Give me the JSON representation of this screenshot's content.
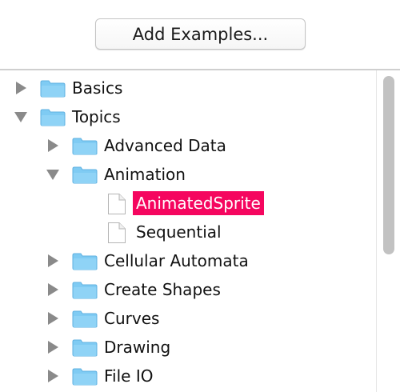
{
  "toolbar": {
    "add_examples_label": "Add Examples..."
  },
  "colors": {
    "folder": "#7fcbf3",
    "selection": "#f5065f",
    "disclosure": "#8a8a8a"
  },
  "tree": {
    "items": [
      {
        "label": "Basics",
        "type": "folder",
        "expanded": false
      },
      {
        "label": "Topics",
        "type": "folder",
        "expanded": true
      },
      {
        "label": "Advanced Data",
        "type": "folder",
        "expanded": false
      },
      {
        "label": "Animation",
        "type": "folder",
        "expanded": true
      },
      {
        "label": "AnimatedSprite",
        "type": "file",
        "selected": true
      },
      {
        "label": "Sequential",
        "type": "file"
      },
      {
        "label": "Cellular Automata",
        "type": "folder",
        "expanded": false
      },
      {
        "label": "Create Shapes",
        "type": "folder",
        "expanded": false
      },
      {
        "label": "Curves",
        "type": "folder",
        "expanded": false
      },
      {
        "label": "Drawing",
        "type": "folder",
        "expanded": false
      },
      {
        "label": "File IO",
        "type": "folder",
        "expanded": false
      }
    ]
  }
}
